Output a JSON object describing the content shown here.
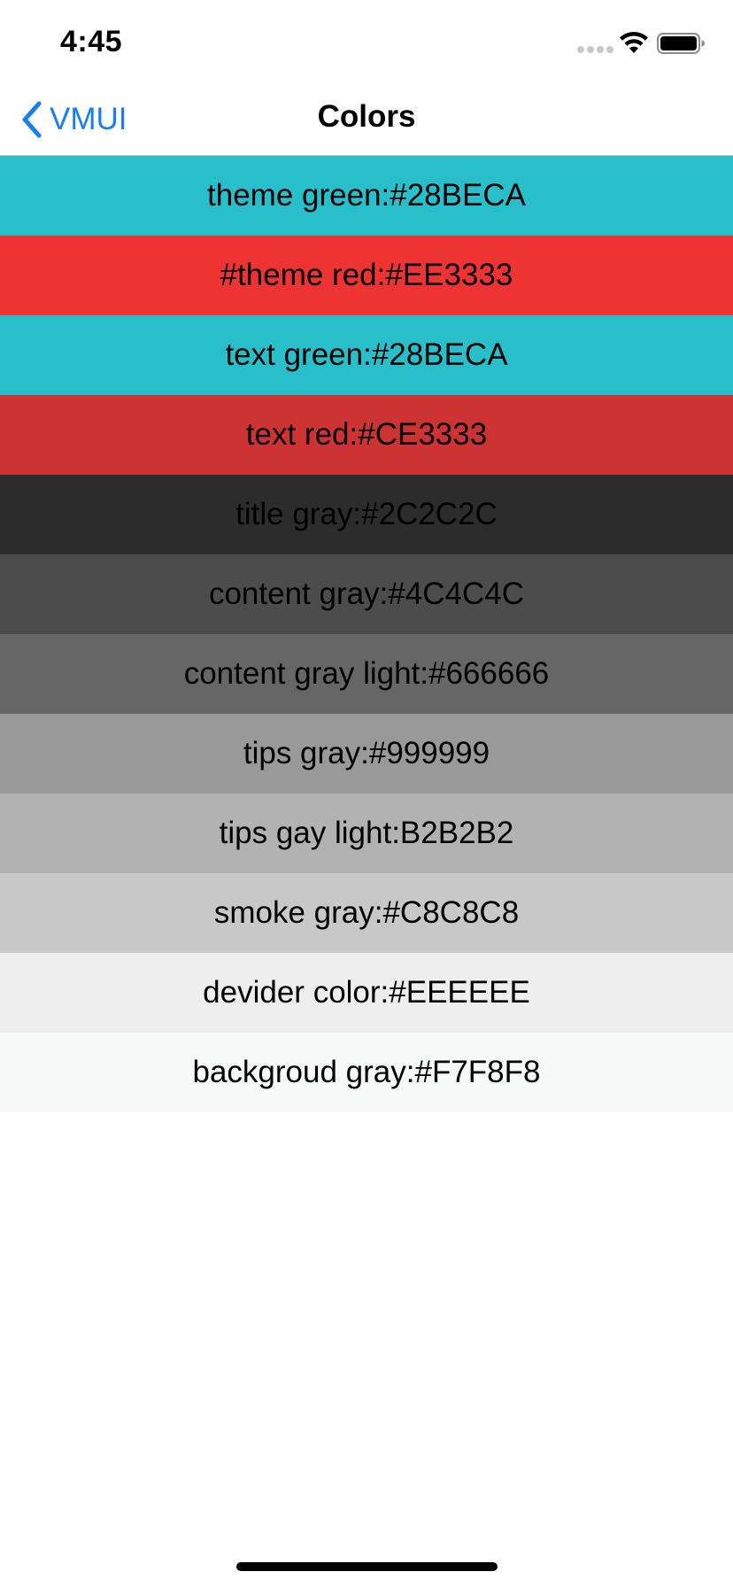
{
  "status_bar": {
    "time": "4:45",
    "wifi_icon": "wifi-icon",
    "battery_icon": "battery-icon"
  },
  "nav": {
    "back_label": "VMUI",
    "back_icon": "chevron-left-icon",
    "title": "Colors"
  },
  "colors": [
    {
      "label": "theme green:#28BECA",
      "hex": "#28BECA"
    },
    {
      "label": "#theme red:#EE3333",
      "hex": "#EE3333"
    },
    {
      "label": "text green:#28BECA",
      "hex": "#28BECA"
    },
    {
      "label": "text red:#CE3333",
      "hex": "#CE3333"
    },
    {
      "label": "title gray:#2C2C2C",
      "hex": "#2C2C2C"
    },
    {
      "label": "content gray:#4C4C4C",
      "hex": "#4C4C4C"
    },
    {
      "label": "content gray light:#666666",
      "hex": "#666666"
    },
    {
      "label": "tips gray:#999999",
      "hex": "#999999"
    },
    {
      "label": "tips gay light:B2B2B2",
      "hex": "#B2B2B2"
    },
    {
      "label": "smoke gray:#C8C8C8",
      "hex": "#C8C8C8"
    },
    {
      "label": "devider color:#EEEEEE",
      "hex": "#EEEEEE"
    },
    {
      "label": "backgroud gray:#F7F8F8",
      "hex": "#F7F8F8"
    }
  ],
  "accent_color": "#1A7DF5"
}
